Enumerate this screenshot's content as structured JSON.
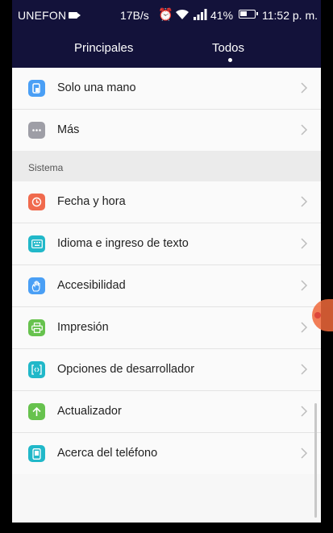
{
  "status_bar": {
    "carrier": "UNEFON",
    "speed": "17B/s",
    "battery": "41%",
    "time": "11:52 p. m."
  },
  "tabs": [
    {
      "label": "Principales"
    },
    {
      "label": "Todos"
    }
  ],
  "items_top": [
    {
      "label": "Solo una mano",
      "icon": "one-hand-icon",
      "color": "#4a9ff5"
    },
    {
      "label": "Más",
      "icon": "more-icon",
      "color": "#9e9ea6"
    }
  ],
  "section": {
    "title": "Sistema"
  },
  "items_system": [
    {
      "label": "Fecha y hora",
      "icon": "clock-icon",
      "color": "#f06a4d"
    },
    {
      "label": "Idioma e ingreso de texto",
      "icon": "keyboard-icon",
      "color": "#21b8c9"
    },
    {
      "label": "Accesibilidad",
      "icon": "hand-icon",
      "color": "#4a9ff5"
    },
    {
      "label": "Impresión",
      "icon": "printer-icon",
      "color": "#67c24e"
    },
    {
      "label": "Opciones de desarrollador",
      "icon": "developer-icon",
      "color": "#21b8c9"
    },
    {
      "label": "Actualizador",
      "icon": "update-arrow-icon",
      "color": "#67c24e"
    },
    {
      "label": "Acerca del teléfono",
      "icon": "phone-icon",
      "color": "#21b8c9"
    }
  ]
}
